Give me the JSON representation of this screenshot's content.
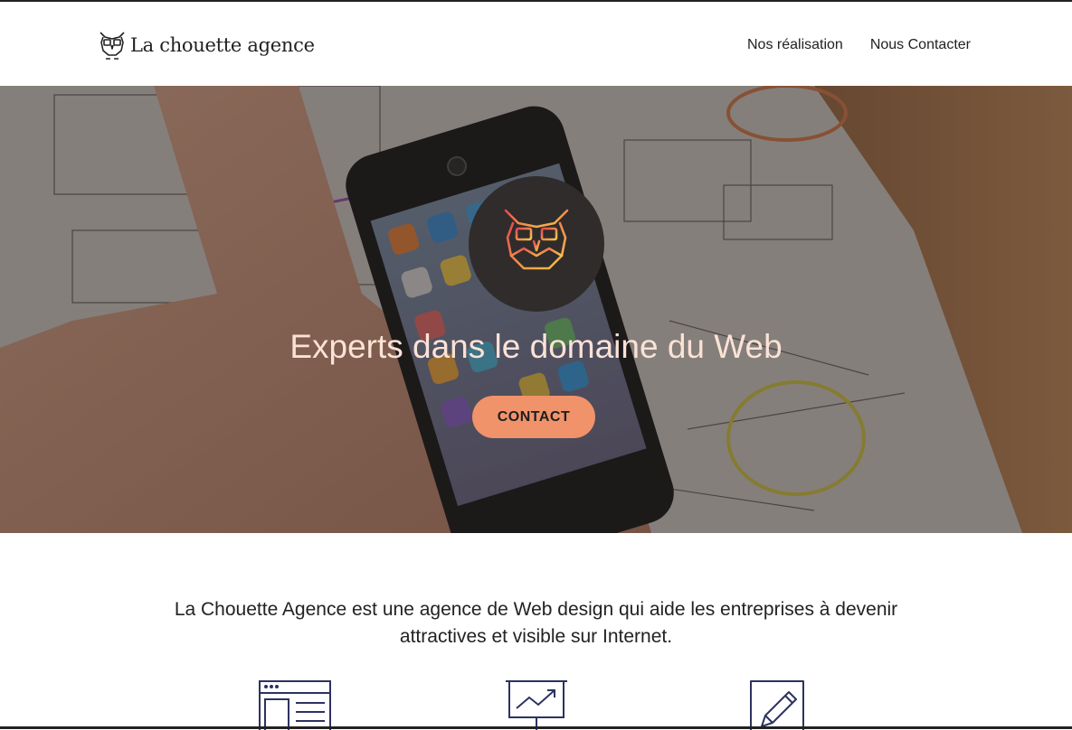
{
  "header": {
    "brand": "La chouette agence",
    "nav": [
      {
        "label": "Nos réalisation"
      },
      {
        "label": "Nous Contacter"
      }
    ]
  },
  "hero": {
    "title": "Experts dans le domaine du Web",
    "cta_label": "CONTACT",
    "colors": {
      "cta": "#f0926a",
      "title": "#fbe2d6",
      "logo_circle": "#2f2c2b"
    }
  },
  "intro": {
    "text": "La Chouette Agence est une agence de Web design qui aide les entreprises à devenir attractives et visible sur Internet."
  },
  "features": [
    {
      "icon": "web-layout-icon"
    },
    {
      "icon": "presentation-chart-icon"
    },
    {
      "icon": "pencil-edit-icon"
    }
  ]
}
